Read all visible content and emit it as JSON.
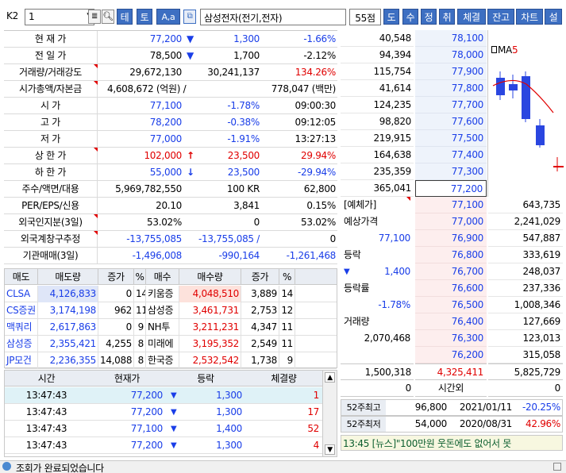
{
  "toolbar": {
    "screen_no": "K2",
    "code": "1",
    "stock_name": "삼성전자(전기,전자)",
    "score": "55점",
    "btn_te": "테",
    "btn_to": "토",
    "btn_aa": "A,a",
    "btn_do": "도",
    "btn_su": "수",
    "btn_jeong": "정",
    "btn_chwi": "취",
    "btn_chegyeol": "체결",
    "btn_jango": "잔고",
    "btn_chart": "차트",
    "btn_seol": "설"
  },
  "info": {
    "rows": [
      {
        "label": "현  재  가",
        "v1": "77,200",
        "arrow": "▼",
        "v2": "1,300",
        "v3": "-1.66%"
      },
      {
        "label": "전  일  가",
        "v1": "78,500",
        "arrow": "▼",
        "v2": "1,700",
        "v3": "-2.12%"
      },
      {
        "label": "거래량/거래강도",
        "v1": "29,672,130",
        "v2": "30,241,137",
        "v3": "134.26%"
      },
      {
        "label": "시가총액/자본금",
        "v1": "4,608,672 (억원) /",
        "v3": "778,047 (백만)"
      },
      {
        "label": "시        가",
        "v1": "77,100",
        "v2": "-1.78%",
        "v3": "09:00:30"
      },
      {
        "label": "고        가",
        "v1": "78,200",
        "v2": "-0.38%",
        "v3": "09:12:05"
      },
      {
        "label": "저        가",
        "v1": "77,000",
        "v2": "-1.91%",
        "v3": "13:27:13"
      },
      {
        "label": "상  한  가",
        "v1": "102,000",
        "arrow": "↑",
        "v2": "23,500",
        "v3": "29.94%"
      },
      {
        "label": "하  한  가",
        "v1": "55,000",
        "arrow": "↓",
        "v2": "23,500",
        "v3": "-29.94%"
      },
      {
        "label": "주수/액면/대용",
        "v1": "5,969,782,550",
        "v2": "100 KR",
        "v3": "62,800"
      },
      {
        "label": "PER/EPS/신용",
        "v1": "20.10",
        "v2": "3,841",
        "v3": "0.15%"
      },
      {
        "label": "외국인지분(3일)",
        "v1": "53.02%",
        "v2": "0",
        "v3": "53.02%"
      },
      {
        "label": "외국계창구추정",
        "v1": "-13,755,085",
        "v2": "-13,755,085  /",
        "v3": "0"
      },
      {
        "label": "기관매매(3일)",
        "v1": "-1,496,008",
        "v2": "-990,164",
        "v3": "-1,261,468"
      }
    ]
  },
  "brokers": {
    "headers": [
      "매도",
      "매도량",
      "증가",
      "%",
      "매수",
      "매수량",
      "증가",
      "%"
    ],
    "rows": [
      {
        "sell": "CLSA증",
        "sell_qty": "4,126,833",
        "sell_inc": "0",
        "sell_pct": "14",
        "buy": "키움증",
        "buy_qty": "4,048,510",
        "buy_inc": "3,889",
        "buy_pct": "14"
      },
      {
        "sell": "CS증권",
        "sell_qty": "3,174,198",
        "sell_inc": "962",
        "sell_pct": "11",
        "buy": "삼성증",
        "buy_qty": "3,461,731",
        "buy_inc": "2,753",
        "buy_pct": "12"
      },
      {
        "sell": "맥쿼리",
        "sell_qty": "2,617,863",
        "sell_inc": "0",
        "sell_pct": "9",
        "buy": "NH투자",
        "buy_qty": "3,211,231",
        "buy_inc": "4,347",
        "buy_pct": "11"
      },
      {
        "sell": "삼성증",
        "sell_qty": "2,355,421",
        "sell_inc": "4,255",
        "sell_pct": "8",
        "buy": "미래에",
        "buy_qty": "3,195,352",
        "buy_inc": "2,549",
        "buy_pct": "11"
      },
      {
        "sell": "JP모건",
        "sell_qty": "2,236,355",
        "sell_inc": "14,088",
        "sell_pct": "8",
        "buy": "한국증",
        "buy_qty": "2,532,542",
        "buy_inc": "1,738",
        "buy_pct": "9"
      }
    ]
  },
  "trades": {
    "headers": [
      "시간",
      "현재가",
      "등락",
      "체결량"
    ],
    "rows": [
      {
        "time": "13:47:43",
        "price": "77,200",
        "change": "1,300",
        "qty": "1"
      },
      {
        "time": "13:47:43",
        "price": "77,200",
        "change": "1,300",
        "qty": "17"
      },
      {
        "time": "13:47:43",
        "price": "77,100",
        "change": "1,400",
        "qty": "52"
      },
      {
        "time": "13:47:43",
        "price": "77,200",
        "change": "1,300",
        "qty": "4"
      }
    ]
  },
  "orderbook": {
    "ask": [
      {
        "qty": "40,548",
        "price": "78,100"
      },
      {
        "qty": "94,394",
        "price": "78,000"
      },
      {
        "qty": "115,754",
        "price": "77,900"
      },
      {
        "qty": "41,614",
        "price": "77,800"
      },
      {
        "qty": "124,235",
        "price": "77,700"
      },
      {
        "qty": "98,820",
        "price": "77,600"
      },
      {
        "qty": "219,915",
        "price": "77,500"
      },
      {
        "qty": "164,638",
        "price": "77,400"
      },
      {
        "qty": "235,359",
        "price": "77,300"
      },
      {
        "qty": "365,041",
        "price": "77,200"
      }
    ],
    "bid": [
      {
        "price": "77,100",
        "qty": "643,735"
      },
      {
        "price": "77,000",
        "qty": "2,241,029"
      },
      {
        "price": "76,900",
        "qty": "547,887"
      },
      {
        "price": "76,800",
        "qty": "333,619"
      },
      {
        "price": "76,700",
        "qty": "248,037"
      },
      {
        "price": "76,600",
        "qty": "237,336"
      },
      {
        "price": "76,500",
        "qty": "1,008,346"
      },
      {
        "price": "76,400",
        "qty": "127,669"
      },
      {
        "price": "76,300",
        "qty": "123,013"
      },
      {
        "price": "76,200",
        "qty": "315,058"
      }
    ],
    "left_info": {
      "est_label": "[예체가]",
      "est_price_label": "예상가격",
      "est_price": "77,100",
      "change_label": "등락",
      "change_val": "1,400",
      "rate_label": "등락률",
      "rate_val": "-1.78%",
      "volume_label": "거래량",
      "volume_val": "2,070,468"
    },
    "total_ask": "1,500,318",
    "total_diff": "4,325,411",
    "total_bid": "5,825,729",
    "after_ask": "0",
    "after_label": "시간외",
    "after_bid": "0",
    "ma_label": "MA",
    "ma_value": "5",
    "week52": [
      {
        "label": "52주최고",
        "price": "96,800",
        "date": "2021/01/11",
        "pct": "-20.25%"
      },
      {
        "label": "52주최저",
        "price": "54,000",
        "date": "2020/08/31",
        "pct": "42.96%"
      }
    ]
  },
  "ticker": "13:45  [뉴스]\"100만원 웃돈에도 없어서 못",
  "status": "조회가 완료되었습니다"
}
